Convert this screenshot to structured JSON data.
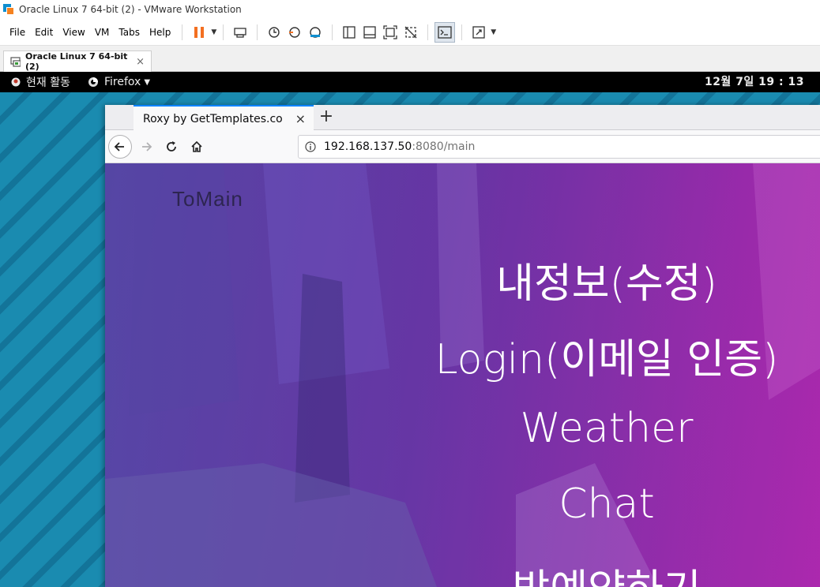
{
  "vmware": {
    "window_title": "Oracle Linux 7 64-bit (2) - VMware Workstation",
    "menu": [
      "File",
      "Edit",
      "View",
      "VM",
      "Tabs",
      "Help"
    ],
    "tab_label": "Oracle Linux 7 64-bit (2)",
    "tab_close": "×"
  },
  "gnome": {
    "activities": "현재 활동",
    "app_name": "Firefox",
    "clock": "12월 7일  19 : 13"
  },
  "firefox": {
    "tab_title": "Roxy by GetTemplates.co",
    "tab_close": "×",
    "new_tab": "+",
    "url_host": "192.168.137.50",
    "url_rest": ":8080/main"
  },
  "page": {
    "brand": "ToMain",
    "links": [
      "내정보(수정)",
      "Login(이메일 인증)",
      "Weather",
      "Chat",
      "방예약하기"
    ]
  },
  "colors": {
    "accent_tab": "#0a84ff",
    "pause_icon": "#f36f21",
    "desktop": "#1a8bb0"
  }
}
